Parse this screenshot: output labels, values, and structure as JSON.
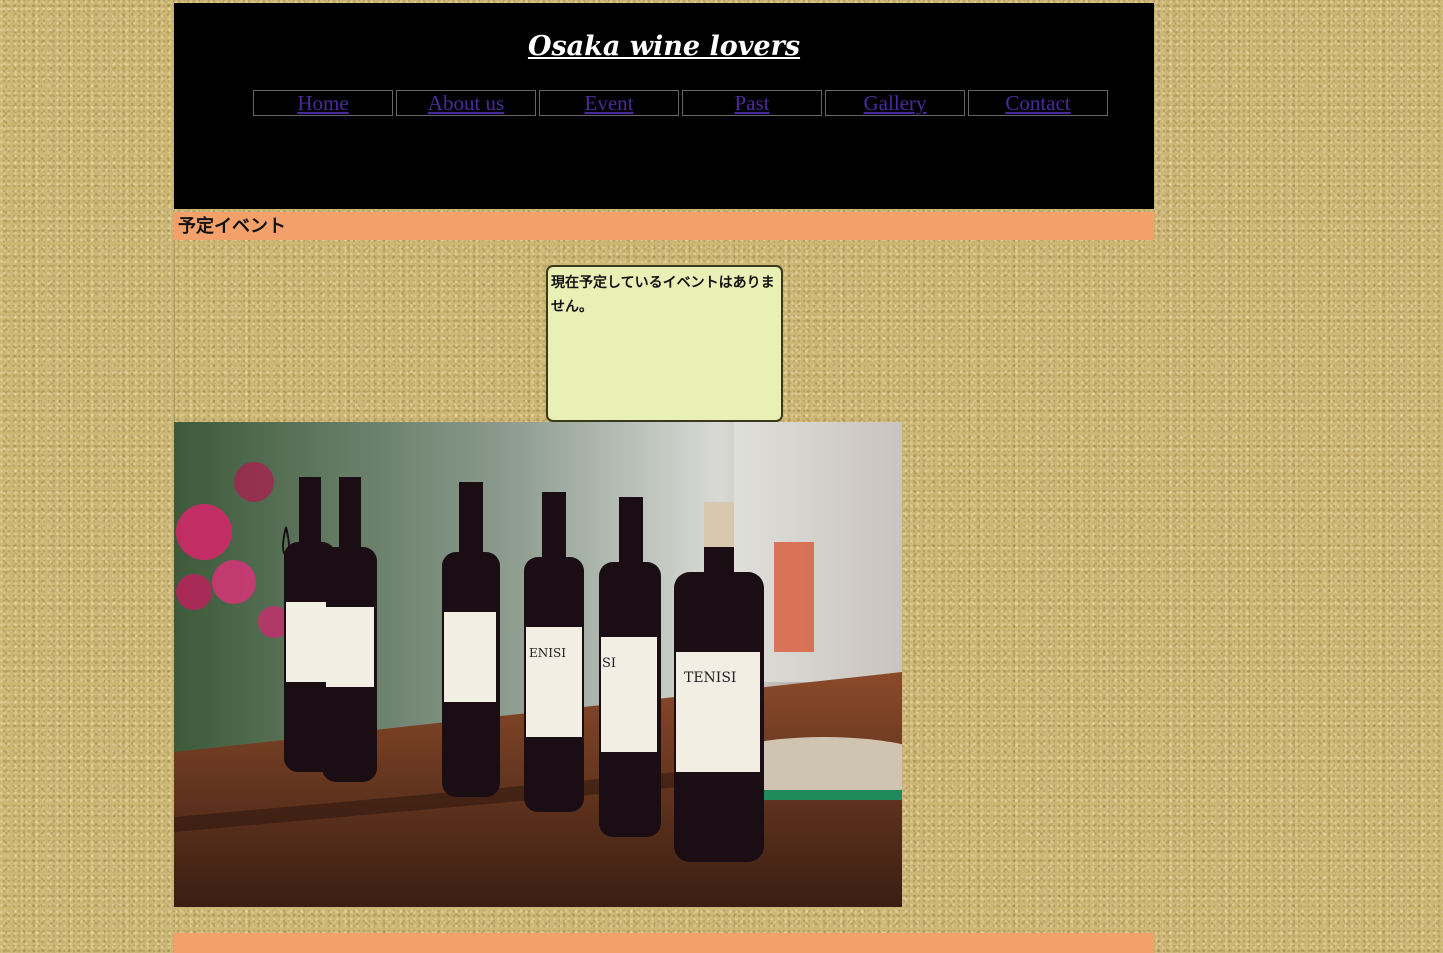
{
  "header": {
    "site_title": "Osaka wine lovers",
    "nav": [
      "Home",
      "About us",
      "Event",
      "Past",
      "Gallery",
      "Contact"
    ]
  },
  "section": {
    "title": "予定イベント"
  },
  "notice": {
    "text": "現在予定しているイベントはありません。"
  },
  "photo": {
    "bottle_labels": [
      "TENISI",
      "SI",
      "ENISI"
    ]
  },
  "colors": {
    "header_bg": "#000000",
    "accent_bar": "#f4a06a",
    "notice_bg": "#e9f0b6",
    "nav_link": "#4a2a9a"
  }
}
